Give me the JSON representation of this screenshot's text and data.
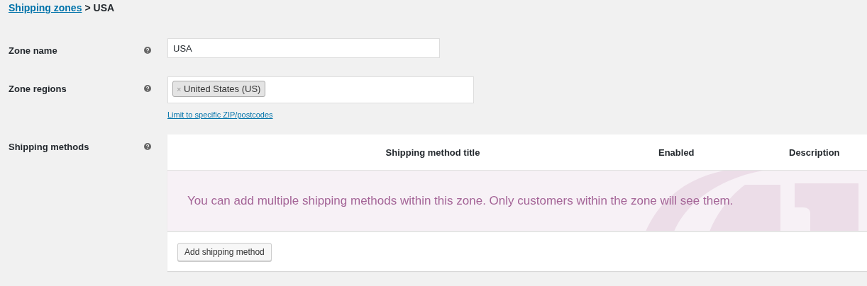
{
  "breadcrumb": {
    "link": "Shipping zones",
    "separator": ">",
    "current": "USA"
  },
  "fields": [
    {
      "kind": "text",
      "label": "Zone name",
      "value": "USA"
    },
    {
      "kind": "tags",
      "label": "Zone regions",
      "tags": [
        "United States (US)"
      ],
      "tag_remove": "×",
      "link": "Limit to specific ZIP/postcodes"
    },
    {
      "kind": "table",
      "label": "Shipping methods",
      "columns": [
        "Shipping method title",
        "Enabled",
        "Description"
      ],
      "empty_message": "You can add multiple shipping methods within this zone. Only customers within the zone will see them.",
      "button": "Add shipping method"
    }
  ]
}
